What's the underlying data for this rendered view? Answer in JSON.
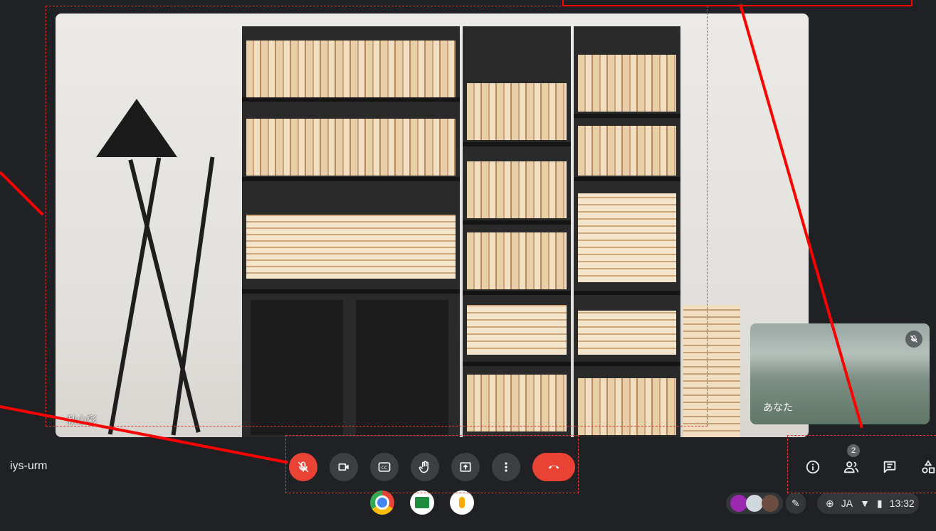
{
  "main_video": {
    "participant_name": "秋山彩"
  },
  "self_view": {
    "name": "あなた"
  },
  "meeting": {
    "code_suffix": "iys-urm"
  },
  "controls": [
    {
      "name": "mic-off-button",
      "icon": "mic-off-icon"
    },
    {
      "name": "camera-button",
      "icon": "camera-icon"
    },
    {
      "name": "captions-button",
      "icon": "cc-icon"
    },
    {
      "name": "raise-hand-button",
      "icon": "hand-icon"
    },
    {
      "name": "present-button",
      "icon": "present-icon"
    },
    {
      "name": "more-options-button",
      "icon": "more-vert-icon"
    },
    {
      "name": "leave-call-button",
      "icon": "call-end-icon"
    }
  ],
  "side_controls": {
    "people_count": "2"
  },
  "status_tray": {
    "language": "JA",
    "time": "13:32"
  },
  "colors": {
    "background": "#202124",
    "button": "#3c4043",
    "danger": "#ea4335",
    "annotation": "#ff0000"
  }
}
